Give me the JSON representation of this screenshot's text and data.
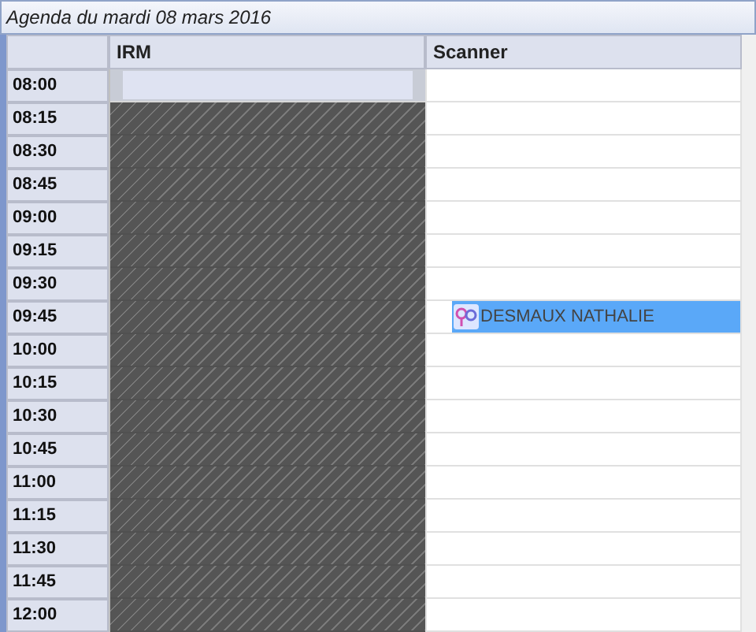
{
  "window": {
    "title": "Agenda du mardi 08 mars 2016"
  },
  "columns": [
    "IRM",
    "Scanner"
  ],
  "rows": [
    {
      "time": "08:00",
      "irm": {
        "kind": "free"
      },
      "scanner": null
    },
    {
      "time": "08:15",
      "irm": {
        "kind": "blocked"
      },
      "scanner": null
    },
    {
      "time": "08:30",
      "irm": {
        "kind": "blocked"
      },
      "scanner": null
    },
    {
      "time": "08:45",
      "irm": {
        "kind": "blocked"
      },
      "scanner": null
    },
    {
      "time": "09:00",
      "irm": {
        "kind": "blocked"
      },
      "scanner": null
    },
    {
      "time": "09:15",
      "irm": {
        "kind": "blocked"
      },
      "scanner": null
    },
    {
      "time": "09:30",
      "irm": {
        "kind": "blocked"
      },
      "scanner": null
    },
    {
      "time": "09:45",
      "irm": {
        "kind": "blocked"
      },
      "scanner": {
        "patient": "DESMAUX NATHALIE"
      }
    },
    {
      "time": "10:00",
      "irm": {
        "kind": "blocked"
      },
      "scanner": null
    },
    {
      "time": "10:15",
      "irm": {
        "kind": "blocked"
      },
      "scanner": null
    },
    {
      "time": "10:30",
      "irm": {
        "kind": "blocked"
      },
      "scanner": null
    },
    {
      "time": "10:45",
      "irm": {
        "kind": "blocked"
      },
      "scanner": null
    },
    {
      "time": "11:00",
      "irm": {
        "kind": "blocked"
      },
      "scanner": null
    },
    {
      "time": "11:15",
      "irm": {
        "kind": "blocked"
      },
      "scanner": null
    },
    {
      "time": "11:30",
      "irm": {
        "kind": "blocked"
      },
      "scanner": null
    },
    {
      "time": "11:45",
      "irm": {
        "kind": "blocked"
      },
      "scanner": null
    },
    {
      "time": "12:00",
      "irm": {
        "kind": "blocked"
      },
      "scanner": null
    }
  ]
}
